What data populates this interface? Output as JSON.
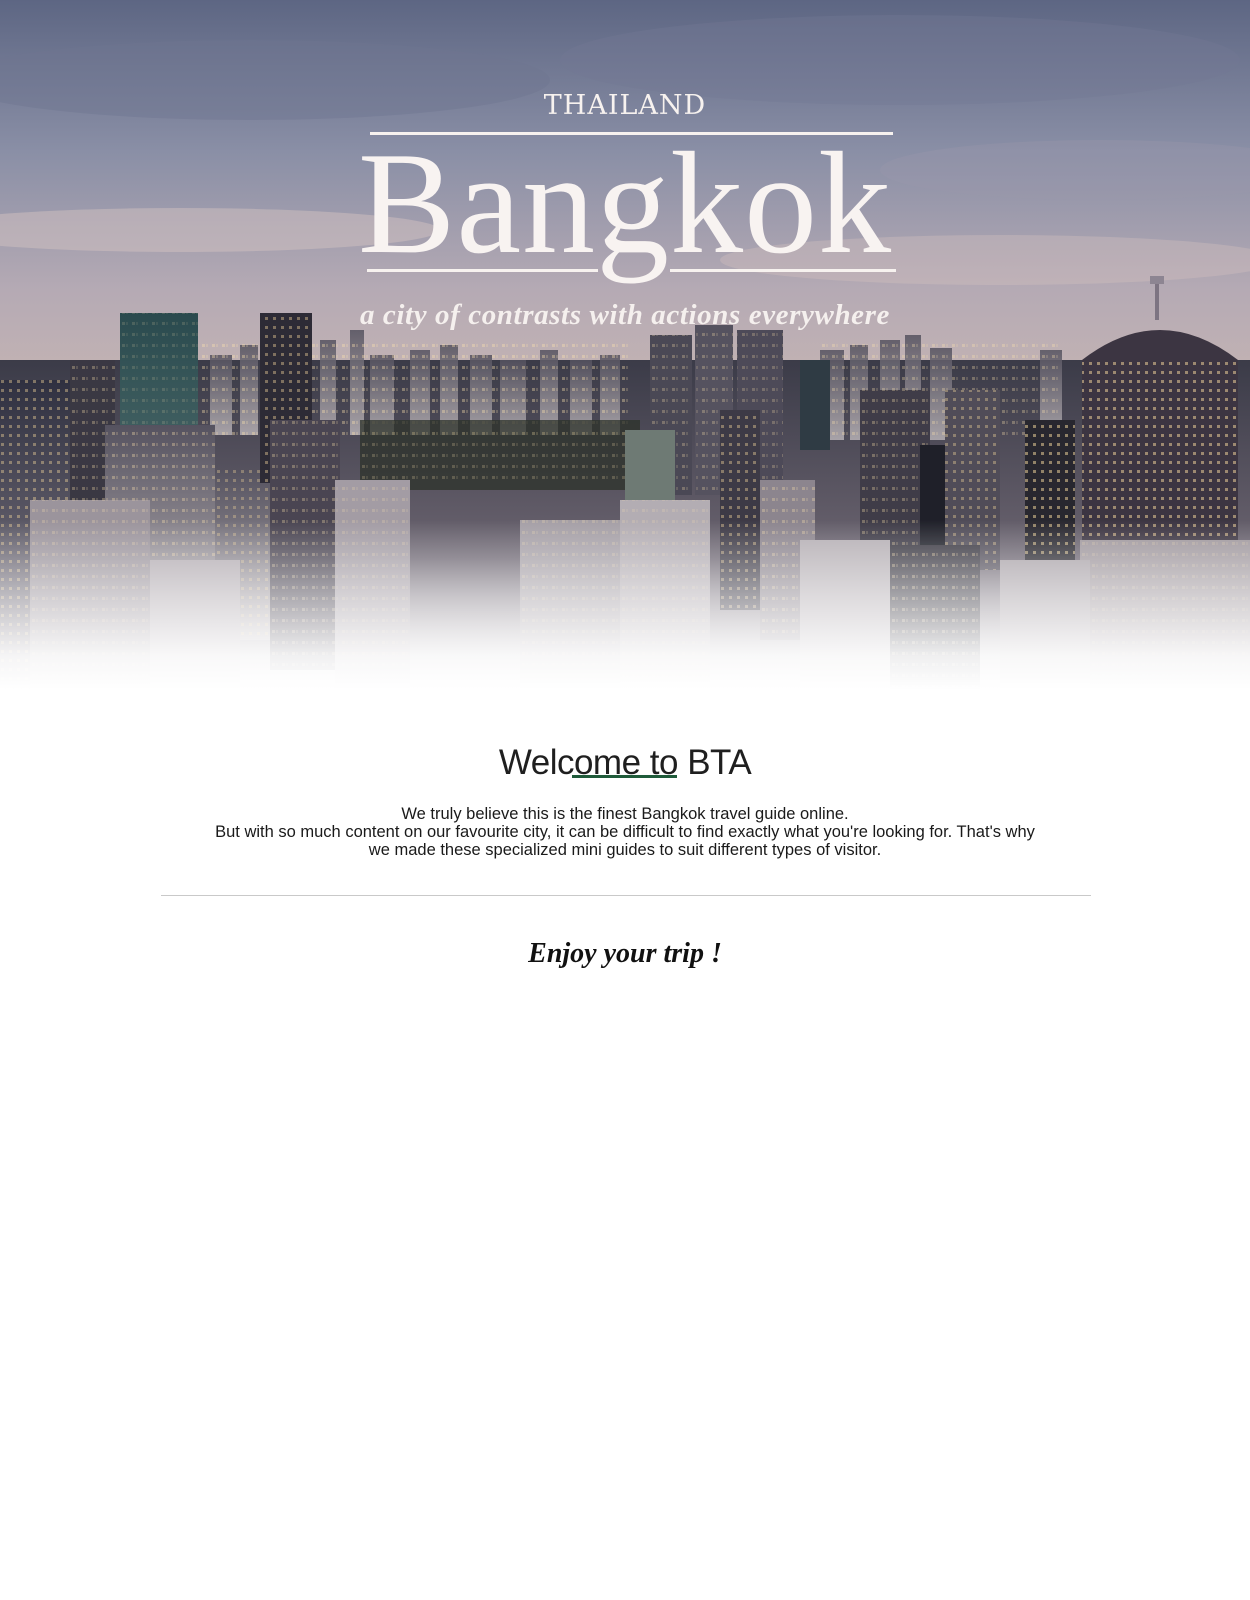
{
  "hero": {
    "country": "THAILAND",
    "city": "Bangkok",
    "tagline": "a city of contrasts with actions everywhere"
  },
  "welcome": {
    "heading": "Welcome to BTA",
    "lines": [
      "We truly believe this is the finest Bangkok travel guide online.",
      "But with so much content on our favourite city, it can be difficult to find exactly what you're looking for. That's why",
      "we made these specialized mini guides to suit different types of visitor."
    ]
  },
  "closing": "Enjoy your trip !",
  "colors": {
    "accent_underline": "#1f5b3a",
    "hero_text": "#f7f2ef",
    "body_text": "#1a1a1a",
    "divider": "#c9c9c9"
  }
}
